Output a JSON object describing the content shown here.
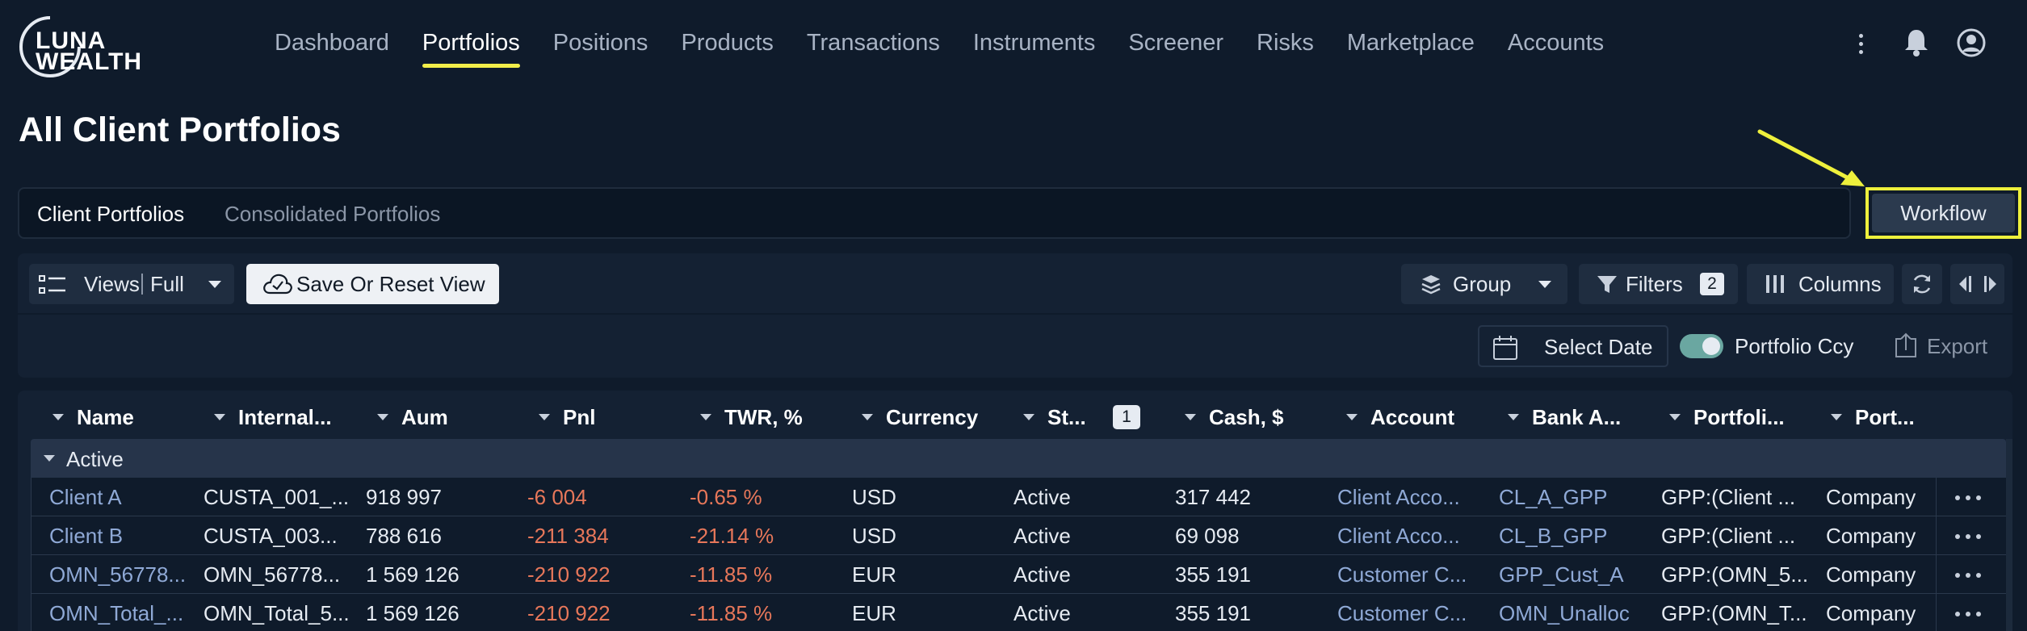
{
  "logo": {
    "line1": "LUNA",
    "line2": "WEALTH"
  },
  "nav": {
    "items": [
      "Dashboard",
      "Portfolios",
      "Positions",
      "Products",
      "Transactions",
      "Instruments",
      "Screener",
      "Risks",
      "Marketplace",
      "Accounts"
    ],
    "active": "Portfolios"
  },
  "icons": {
    "more": "more-vertical-icon",
    "notifications": "bell-icon",
    "profile": "user-circle-icon"
  },
  "page": {
    "title": "All Client Portfolios"
  },
  "tabs": {
    "client": "Client Portfolios",
    "consolidated": "Consolidated Portfolios"
  },
  "workflow": {
    "label": "Workflow"
  },
  "toolbar": {
    "views_label": "Views",
    "views_value": "Full",
    "save_label": "Save Or Reset View",
    "group_label": "Group",
    "filters_label": "Filters",
    "filters_count": "2",
    "columns_label": "Columns",
    "select_date": "Select Date",
    "portfolio_ccy": "Portfolio Ccy",
    "portfolio_ccy_on": true,
    "export_label": "Export"
  },
  "grid": {
    "columns": [
      "Name",
      "Internal...",
      "Aum",
      "Pnl",
      "TWR, %",
      "Currency",
      "St...",
      "Cash, $",
      "Account",
      "Bank A...",
      "Portfoli...",
      "Port..."
    ],
    "status_filter_badge": "1",
    "group": "Active",
    "rows": [
      [
        "Client A",
        "CUSTA_001_...",
        "918 997",
        "-6 004",
        "-0.65 %",
        "USD",
        "Active",
        "317 442",
        "Client Acco...",
        "CL_A_GPP",
        "GPP:(Client ...",
        "Company"
      ],
      [
        "Client B",
        "CUSTA_003...",
        "788 616",
        "-211 384",
        "-21.14 %",
        "USD",
        "Active",
        "69 098",
        "Client Acco...",
        "CL_B_GPP",
        "GPP:(Client ...",
        "Company"
      ],
      [
        "OMN_56778...",
        "OMN_56778...",
        "1 569 126",
        "-210 922",
        "-11.85 %",
        "EUR",
        "Active",
        "355 191",
        "Customer C...",
        "GPP_Cust_A",
        "GPP:(OMN_5...",
        "Company"
      ],
      [
        "OMN_Total_...",
        "OMN_Total_5...",
        "1 569 126",
        "-210 922",
        "-11.85 %",
        "EUR",
        "Active",
        "355 191",
        "Customer C...",
        "OMN_Unalloc",
        "GPP:(OMN_T...",
        "Company"
      ]
    ]
  },
  "colors": {
    "background": "#0f1b2b",
    "highlight": "#eef03c",
    "negative": "#e7775a",
    "link": "#8fa9d6",
    "toggle": "#6aa7a1"
  }
}
